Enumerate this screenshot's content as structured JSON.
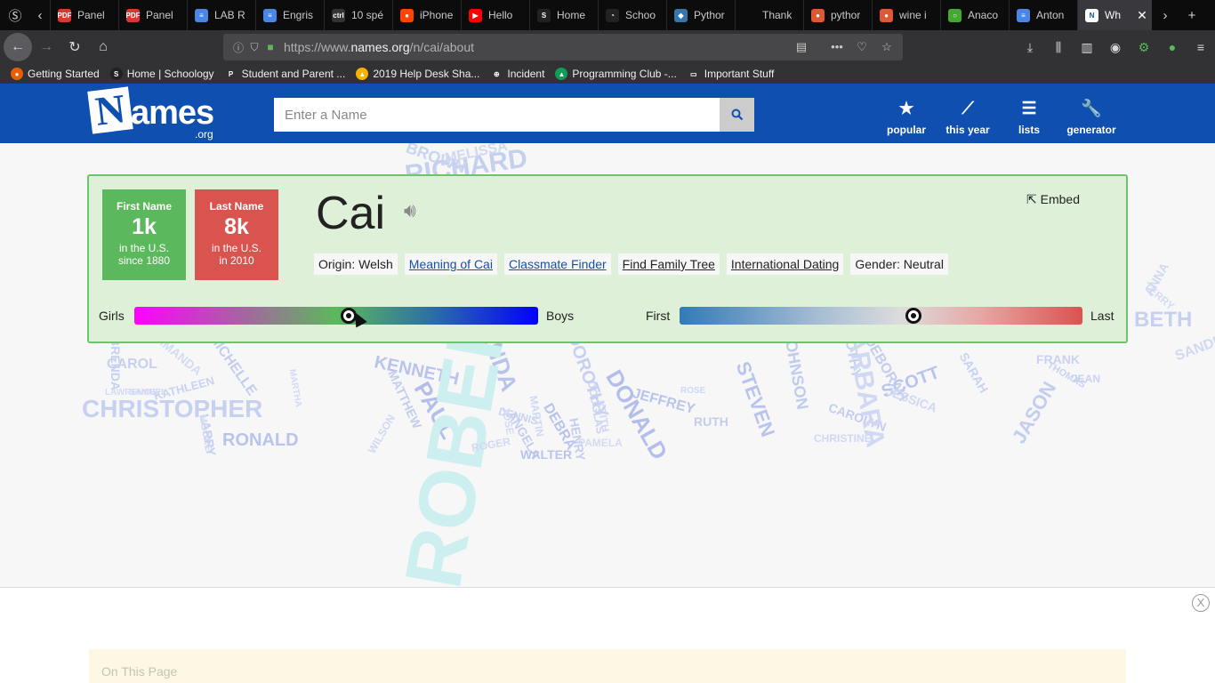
{
  "browser": {
    "tabs": [
      {
        "label": "Panel",
        "icon": "pdf-icon",
        "color": "#d43a2f",
        "glyph": "PDF"
      },
      {
        "label": "Panel",
        "icon": "pdf-icon",
        "color": "#d43a2f",
        "glyph": "PDF"
      },
      {
        "label": "LAB R",
        "icon": "docs-icon",
        "color": "#4a86e8",
        "glyph": "≡"
      },
      {
        "label": "Engris",
        "icon": "docs-icon",
        "color": "#4a86e8",
        "glyph": "≡"
      },
      {
        "label": "10 spé",
        "icon": "ctrl-icon",
        "color": "#333333",
        "glyph": "ctrl"
      },
      {
        "label": "iPhone",
        "icon": "reddit-icon",
        "color": "#ff4500",
        "glyph": "●"
      },
      {
        "label": "Hello",
        "icon": "youtube-icon",
        "color": "#ff0000",
        "glyph": "▶"
      },
      {
        "label": "Home",
        "icon": "schoology-icon",
        "color": "#222222",
        "glyph": "S"
      },
      {
        "label": "Schoo",
        "icon": "loading-icon",
        "color": "#222222",
        "glyph": "◔"
      },
      {
        "label": "Pythor",
        "icon": "python-icon",
        "color": "#3776ab",
        "glyph": "◆"
      },
      {
        "label": "Thank",
        "icon": "blank-icon",
        "color": "#0c0c0d",
        "glyph": ""
      },
      {
        "label": "pythor",
        "icon": "duckduckgo-icon",
        "color": "#de5833",
        "glyph": "●"
      },
      {
        "label": "wine i",
        "icon": "duckduckgo-icon",
        "color": "#de5833",
        "glyph": "●"
      },
      {
        "label": "Anaco",
        "icon": "anaconda-icon",
        "color": "#44a833",
        "glyph": "○"
      },
      {
        "label": "Anton",
        "icon": "docs-icon",
        "color": "#4a86e8",
        "glyph": "≡"
      }
    ],
    "active_tab": {
      "label": "Wh",
      "icon": "names-icon",
      "glyph": "N"
    },
    "url_prefix": "https://www.",
    "url_domain": "names.org",
    "url_path": "/n/cai/about",
    "bookmarks": [
      {
        "label": "Getting Started",
        "icon": "firefox-icon",
        "color": "#e66000",
        "glyph": "●"
      },
      {
        "label": "Home | Schoology",
        "icon": "schoology-icon",
        "color": "#222222",
        "glyph": "S"
      },
      {
        "label": "Student and Parent ...",
        "icon": "powerschool-icon",
        "color": "#323234",
        "glyph": "P"
      },
      {
        "label": "2019 Help Desk Sha...",
        "icon": "drive-icon",
        "color": "#f4b400",
        "glyph": "▲"
      },
      {
        "label": "Incident",
        "icon": "globe-icon",
        "color": "#323234",
        "glyph": "⊕"
      },
      {
        "label": "Programming Club -...",
        "icon": "drive-icon",
        "color": "#0f9d58",
        "glyph": "▲"
      },
      {
        "label": "Important Stuff",
        "icon": "folder-icon",
        "color": "#323234",
        "glyph": "▭"
      }
    ]
  },
  "site": {
    "logo_text": "Names",
    "logo_suffix": ".org",
    "search_placeholder": "Enter a Name",
    "nav": [
      {
        "label": "popular",
        "icon": "star-icon",
        "glyph": "★"
      },
      {
        "label": "this year",
        "icon": "trend-chart-icon",
        "glyph": "⟋"
      },
      {
        "label": "lists",
        "icon": "list-icon",
        "glyph": "☰"
      },
      {
        "label": "generator",
        "icon": "wrench-icon",
        "glyph": "🔧"
      }
    ]
  },
  "name_card": {
    "name": "Cai",
    "embed_label": "Embed",
    "first_name": {
      "title": "First Name",
      "value": "1k",
      "line1": "in the U.S.",
      "line2": "since 1880"
    },
    "last_name": {
      "title": "Last Name",
      "value": "8k",
      "line1": "in the U.S.",
      "line2": "in 2010"
    },
    "tags": [
      {
        "label": "Origin: Welsh",
        "link": false
      },
      {
        "label": "Meaning of Cai",
        "link": true
      },
      {
        "label": "Classmate Finder",
        "link": true
      },
      {
        "label": "Find Family Tree",
        "link": true
      },
      {
        "label": "International Dating",
        "link": true
      },
      {
        "label": "Gender: Neutral",
        "link": false
      }
    ],
    "gender_slider": {
      "left_label": "Girls",
      "right_label": "Boys",
      "position": 0.53
    },
    "firstlast_slider": {
      "left_label": "First",
      "right_label": "Last",
      "position": 0.58
    }
  },
  "background_names": [
    "RICHARD",
    "BROWN",
    "MELISSA",
    "KENNETH",
    "PAUL",
    "LINDA",
    "DONALD",
    "JEFFREY",
    "STEVEN",
    "JOHNSON",
    "CHRISTOPHER",
    "RONALD",
    "LARRY",
    "CAROL",
    "KATHLEEN",
    "MICHELLE",
    "RUTH",
    "MATTHEW",
    "DENNIS",
    "ANGELA",
    "DEBRA",
    "WALTER",
    "DOUGLAS",
    "DOROTHY",
    "SCOTT",
    "JASON",
    "DEBORAH",
    "CAROLYN",
    "SARAH",
    "FRANK",
    "JEAN",
    "THOMAS",
    "SANDRA",
    "BETH",
    "ANNA",
    "TERRY",
    "ROBERT",
    "BRENDA",
    "SAMUEL",
    "CHRISTINE",
    "ROSE",
    "HENRY",
    "WILSON",
    "ROGER",
    "JESSICA",
    "MARTIN",
    "TIMOTHY",
    "BARBARA",
    "PAMELA",
    "KEITH",
    "MOORE",
    "LAWRENCE",
    "MARTHA",
    "AMANDA",
    "JOSE",
    "KATHY"
  ],
  "footer": {
    "close_label": "X",
    "on_this_page": "On This Page"
  }
}
